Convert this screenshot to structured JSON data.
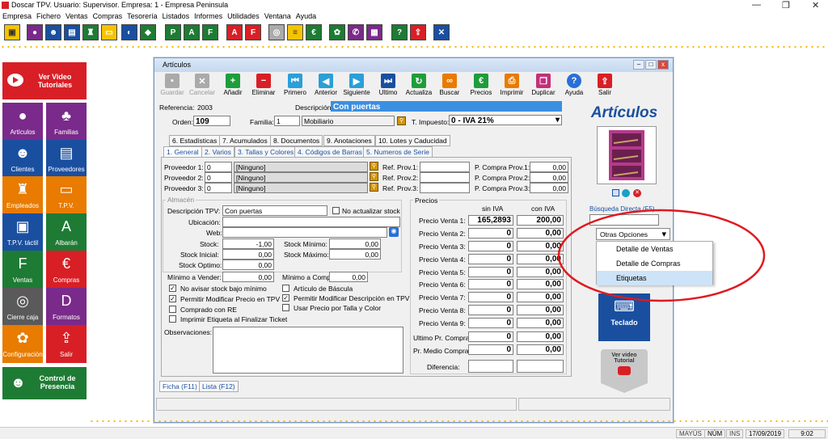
{
  "titlebar": {
    "title": "Doscar TPV. Usuario: Supervisor. Empresa: 1 - Empresa Peninsula"
  },
  "menu": [
    "Empresa",
    "Fichero",
    "Ventas",
    "Compras",
    "Tesorería",
    "Listados",
    "Informes",
    "Utilidades",
    "Ventana",
    "Ayuda"
  ],
  "left_panel": {
    "video": "Ver Video Tutoriales",
    "tiles": [
      "Artículos",
      "Familias",
      "Clientes",
      "Proveedores",
      "Empleados",
      "T.P.V.",
      "T.P.V. táctil",
      "Albarán",
      "Ventas",
      "Compras",
      "Cierre caja",
      "Formatos",
      "Configuración",
      "Salir"
    ],
    "presencia": "Control de Presencia"
  },
  "window": {
    "title": "Artículos",
    "toolbar": [
      "Guardar",
      "Cancelar",
      "Añadir",
      "Eliminar",
      "Primero",
      "Anterior",
      "Siguiente",
      "Ultimo",
      "Actualiza",
      "Buscar",
      "Precios",
      "Imprimir",
      "Duplicar",
      "Ayuda",
      "Salir"
    ],
    "referencia_label": "Referencia:",
    "referencia": "2003",
    "descripcion_label": "Descripción:",
    "descripcion": "Con puertas",
    "orden_label": "Orden:",
    "orden": "109",
    "familia_label": "Familia:",
    "familia": "1",
    "familia_name": "Mobiliario",
    "impuesto_label": "T. Impuesto:",
    "impuesto": "0 - IVA 21%",
    "tabs_top": [
      "6. Estadísticas",
      "7. Acumulados",
      "8. Documentos",
      "9. Anotaciones",
      "10. Lotes y Caducidad"
    ],
    "tabs_bottom": [
      "1. General",
      "2. Varios",
      "3. Tallas y Colores",
      "4. Códigos de Barras",
      "5. Numeros de Serie"
    ],
    "proveedores": [
      {
        "label": "Proveedor 1:",
        "code": "0",
        "name": "[Ninguno]",
        "ref_label": "Ref. Prov.1:",
        "pc_label": "P. Compra Prov.1:",
        "pc": "0,00"
      },
      {
        "label": "Proveedor 2:",
        "code": "0",
        "name": "[Ninguno]",
        "ref_label": "Ref. Prov.2:",
        "pc_label": "P. Compra Prov.2:",
        "pc": "0,00"
      },
      {
        "label": "Proveedor 3:",
        "code": "0",
        "name": "[Ninguno]",
        "ref_label": "Ref. Prov.3:",
        "pc_label": "P. Compra Prov.3:",
        "pc": "0,00"
      }
    ],
    "almacen": {
      "title": "Almacén",
      "desc_tpv_label": "Descripción TPV:",
      "desc_tpv": "Con puertas",
      "no_actualizar": "No actualizar stock",
      "ubicacion_label": "Ubicación:",
      "web_label": "Web:",
      "stock_label": "Stock:",
      "stock": "-1,00",
      "stock_min_label": "Stock Mínimo:",
      "stock_min": "0,00",
      "stock_ini_label": "Stock Inicial:",
      "stock_ini": "0,00",
      "stock_max_label": "Stock Máximo:",
      "stock_max": "0,00",
      "stock_opt_label": "Stock Optimo:",
      "stock_opt": "0,00",
      "min_vender_label": "Mínimo a Vender:",
      "min_vender": "0,00",
      "min_comprar_label": "Mínimo a Comprar:",
      "min_comprar": "0,00"
    },
    "checks": {
      "no_avisar": "No avisar stock bajo mínimo",
      "bascula": "Artículo de Báscula",
      "permitir_precio": "Permitir Modificar Precio en TPV",
      "permitir_desc": "Permitir Modificar Descripción en TPV",
      "comprado_re": "Comprado con RE",
      "precio_talla": "Usar Precio por Talla y Color",
      "imprimir_etiqueta": "Imprimir Etiqueta al Finalizar Ticket"
    },
    "observaciones_label": "Observaciones:",
    "precios": {
      "title": "Precios",
      "sin_iva": "sin IVA",
      "con_iva": "con IVA",
      "rows": [
        {
          "label": "Precio Venta 1:",
          "sin": "165,2893",
          "con": "200,00"
        },
        {
          "label": "Precio Venta 2:",
          "sin": "0",
          "con": "0,00"
        },
        {
          "label": "Precio Venta 3:",
          "sin": "0",
          "con": "0,00"
        },
        {
          "label": "Precio Venta 4:",
          "sin": "0",
          "con": "0,00"
        },
        {
          "label": "Precio Venta 5:",
          "sin": "0",
          "con": "0,00"
        },
        {
          "label": "Precio Venta 6:",
          "sin": "0",
          "con": "0,00"
        },
        {
          "label": "Precio Venta 7:",
          "sin": "0",
          "con": "0,00"
        },
        {
          "label": "Precio Venta 8:",
          "sin": "0",
          "con": "0,00"
        },
        {
          "label": "Precio Venta 9:",
          "sin": "0",
          "con": "0,00"
        }
      ],
      "ultimo_label": "Ultimo Pr. Compra:",
      "ultimo_sin": "0",
      "ultimo_con": "0,00",
      "medio_label": "Pr. Medio Compra:",
      "medio_sin": "0",
      "medio_con": "0,00",
      "diferencia_label": "Diferencia:"
    },
    "bottom_tabs": [
      "Ficha (F11)",
      "Lista (F12)"
    ],
    "right": {
      "heading": "Artículos",
      "busqueda": "Búsqueda Directa (F5)",
      "otras": "Otras Opciones",
      "menu": [
        "Detalle de Ventas",
        "Detalle de Compras",
        "Etiquetas"
      ],
      "teclado": "Teclado",
      "video": "Ver video Tutorial"
    }
  },
  "status": {
    "mayus": "MAYÚS",
    "num": "NÚM",
    "ins": "INS",
    "date": "17/09/2019",
    "time": "9:02"
  },
  "colors": {
    "red": "#d81f26",
    "green": "#1e7b34",
    "blue": "#1a4fa0",
    "purple": "#7a2a8a",
    "orange": "#e87b00",
    "gray": "#5a5a5a",
    "highlight": "#cde3f7"
  }
}
